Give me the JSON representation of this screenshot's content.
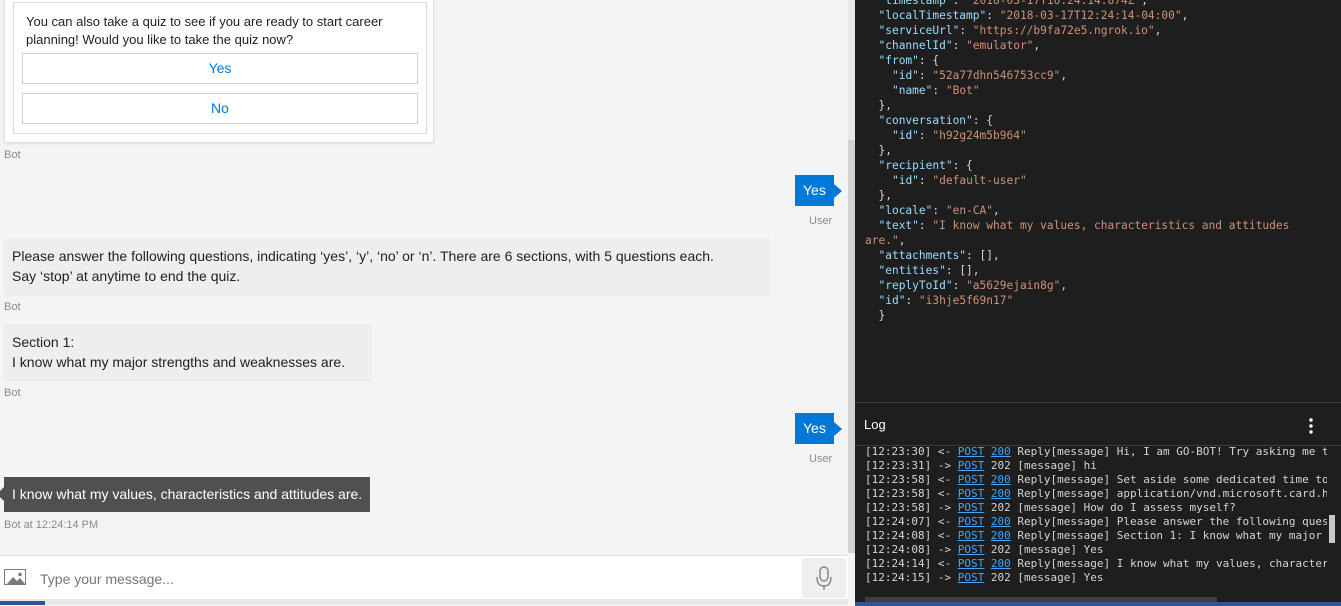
{
  "chat": {
    "card": {
      "text": "You can also take a quiz to see if you are ready to start career planning! Would you like to take the quiz now?",
      "buttons": [
        "Yes",
        "No"
      ],
      "sender": "Bot"
    },
    "messages": [
      {
        "type": "user",
        "text": "Yes",
        "sender": "User"
      },
      {
        "type": "bot",
        "lines": [
          "Please answer the following questions, indicating ‘yes’, ‘y’, ‘no’ or ‘n’. There are 6 sections, with 5 questions each.",
          "Say ‘stop’ at anytime to end the quiz."
        ],
        "sender": "Bot"
      },
      {
        "type": "bot",
        "lines": [
          "Section 1:",
          "I know what my major strengths and weaknesses are."
        ],
        "sender": "Bot"
      },
      {
        "type": "user",
        "text": "Yes",
        "sender": "User"
      },
      {
        "type": "bot-selected",
        "text": "I know what my values, characteristics and attitudes are.",
        "sender": "Bot at 12:24:14 PM"
      }
    ],
    "input": {
      "placeholder": "Type your message..."
    }
  },
  "json_panel": {
    "lines": [
      [
        {
          "k": "\"timestamp\""
        },
        {
          "p": ": "
        },
        {
          "s": "\"2018-03-17T16:24:14.874Z\""
        },
        {
          "p": ","
        }
      ],
      [
        {
          "k": "\"localTimestamp\""
        },
        {
          "p": ": "
        },
        {
          "s": "\"2018-03-17T12:24:14-04:00\""
        },
        {
          "p": ","
        }
      ],
      [
        {
          "k": "\"serviceUrl\""
        },
        {
          "p": ": "
        },
        {
          "s": "\"https://b9fa72e5.ngrok.io\""
        },
        {
          "p": ","
        }
      ],
      [
        {
          "k": "\"channelId\""
        },
        {
          "p": ": "
        },
        {
          "s": "\"emulator\""
        },
        {
          "p": ","
        }
      ],
      [
        {
          "k": "\"from\""
        },
        {
          "p": ": {"
        }
      ],
      [
        {
          "p": "  "
        },
        {
          "k": "\"id\""
        },
        {
          "p": ": "
        },
        {
          "s": "\"52a77dhn546753cc9\""
        },
        {
          "p": ","
        }
      ],
      [
        {
          "p": "  "
        },
        {
          "k": "\"name\""
        },
        {
          "p": ": "
        },
        {
          "s": "\"Bot\""
        }
      ],
      [
        {
          "p": "},"
        }
      ],
      [
        {
          "k": "\"conversation\""
        },
        {
          "p": ": {"
        }
      ],
      [
        {
          "p": "  "
        },
        {
          "k": "\"id\""
        },
        {
          "p": ": "
        },
        {
          "s": "\"h92g24m5b964\""
        }
      ],
      [
        {
          "p": "},"
        }
      ],
      [
        {
          "k": "\"recipient\""
        },
        {
          "p": ": {"
        }
      ],
      [
        {
          "p": "  "
        },
        {
          "k": "\"id\""
        },
        {
          "p": ": "
        },
        {
          "s": "\"default-user\""
        }
      ],
      [
        {
          "p": "},"
        }
      ],
      [
        {
          "k": "\"locale\""
        },
        {
          "p": ": "
        },
        {
          "s": "\"en-CA\""
        },
        {
          "p": ","
        }
      ],
      [
        {
          "k": "\"text\""
        },
        {
          "p": ": "
        },
        {
          "s": "\"I know what my values, characteristics and attitudes"
        }
      ],
      [
        {
          "s": "are.\""
        },
        {
          "p": ","
        }
      ],
      [
        {
          "k": "\"attachments\""
        },
        {
          "p": ": [],"
        }
      ],
      [
        {
          "k": "\"entities\""
        },
        {
          "p": ": [],"
        }
      ],
      [
        {
          "k": "\"replyToId\""
        },
        {
          "p": ": "
        },
        {
          "s": "\"a5629ejain8g\""
        },
        {
          "p": ","
        }
      ],
      [
        {
          "k": "\"id\""
        },
        {
          "p": ": "
        },
        {
          "s": "\"i3hje5f69n17\""
        }
      ],
      [
        {
          "p": "}"
        }
      ]
    ]
  },
  "log": {
    "title": "Log",
    "entries": [
      {
        "time": "[12:23:30]",
        "dir": "<-",
        "method": "POST",
        "status": "200",
        "link_status": true,
        "msg": "Reply[message] Hi, I am GO-BOT! Try asking me t"
      },
      {
        "time": "[12:23:31]",
        "dir": "->",
        "method": "POST",
        "status": "202",
        "link_status": false,
        "msg": "[message] hi"
      },
      {
        "time": "[12:23:58]",
        "dir": "<-",
        "method": "POST",
        "status": "200",
        "link_status": true,
        "msg": "Reply[message] Set aside some dedicated time to"
      },
      {
        "time": "[12:23:58]",
        "dir": "<-",
        "method": "POST",
        "status": "200",
        "link_status": true,
        "msg": "Reply[message] application/vnd.microsoft.card.h"
      },
      {
        "time": "[12:23:58]",
        "dir": "->",
        "method": "POST",
        "status": "202",
        "link_status": false,
        "msg": "[message] How do I assess myself?"
      },
      {
        "time": "[12:24:07]",
        "dir": "<-",
        "method": "POST",
        "status": "200",
        "link_status": true,
        "msg": "Reply[message] Please answer the following ques"
      },
      {
        "time": "[12:24:08]",
        "dir": "<-",
        "method": "POST",
        "status": "200",
        "link_status": true,
        "msg": "Reply[message] Section 1: I know what my major"
      },
      {
        "time": "[12:24:08]",
        "dir": "->",
        "method": "POST",
        "status": "202",
        "link_status": false,
        "msg": "[message] Yes"
      },
      {
        "time": "[12:24:14]",
        "dir": "<-",
        "method": "POST",
        "status": "200",
        "link_status": true,
        "msg": "Reply[message] I know what my values, character"
      },
      {
        "time": "[12:24:15]",
        "dir": "->",
        "method": "POST",
        "status": "202",
        "link_status": false,
        "msg": "[message] Yes"
      }
    ]
  },
  "colors": {
    "accent": "#0078d7",
    "json_key": "#9cdcfe",
    "json_string": "#ce9178",
    "log_link": "#3ea6ff"
  }
}
